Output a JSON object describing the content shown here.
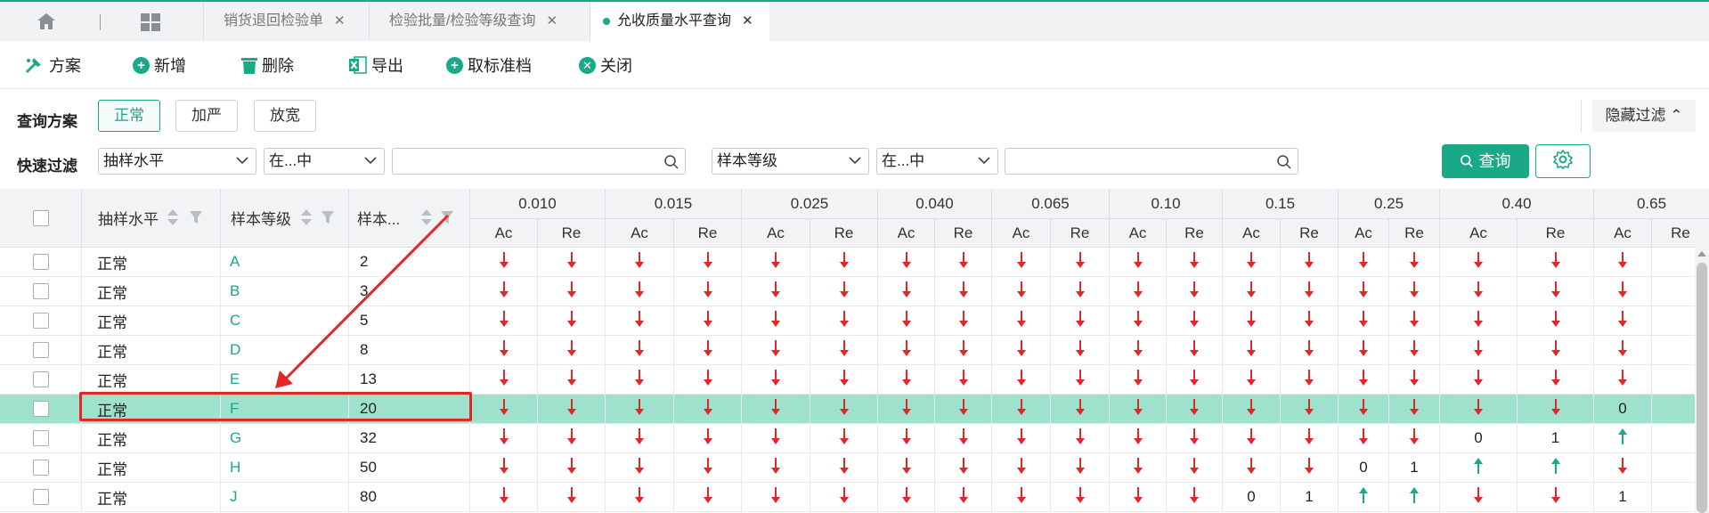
{
  "tabs": [
    {
      "label": "销货退回检验单",
      "active": false
    },
    {
      "label": "检验批量/检验等级查询",
      "active": false
    },
    {
      "label": "允收质量水平查询",
      "active": true
    }
  ],
  "toolbar": {
    "scheme": "方案",
    "add": "新增",
    "delete": "删除",
    "export": "导出",
    "cancel_std": "取标准档",
    "close": "关闭"
  },
  "filter": {
    "scheme_label": "查询方案",
    "schemes": [
      "正常",
      "加严",
      "放宽"
    ],
    "quick_label": "快速过滤",
    "hide_label": "隐藏过滤",
    "field1": "抽样水平",
    "op1": "在...中",
    "value1": "",
    "field2": "样本等级",
    "op2": "在...中",
    "value2": "",
    "query_label": "查询"
  },
  "table": {
    "col_headers": [
      "抽样水平",
      "样本等级",
      "样本..."
    ],
    "aql_levels": [
      "0.010",
      "0.015",
      "0.025",
      "0.040",
      "0.065",
      "0.10",
      "0.15",
      "0.25",
      "0.40",
      "0.65"
    ],
    "sub_ac": "Ac",
    "sub_re": "Re",
    "rows": [
      {
        "level": "正常",
        "grade": "A",
        "size": "2",
        "vals": [
          "d",
          "d",
          "d",
          "d",
          "d",
          "d",
          "d",
          "d",
          "d",
          "d",
          "d",
          "d",
          "d",
          "d",
          "d",
          "d",
          "d",
          "d",
          "d"
        ],
        "highlight": false
      },
      {
        "level": "正常",
        "grade": "B",
        "size": "3",
        "vals": [
          "d",
          "d",
          "d",
          "d",
          "d",
          "d",
          "d",
          "d",
          "d",
          "d",
          "d",
          "d",
          "d",
          "d",
          "d",
          "d",
          "d",
          "d",
          "d"
        ],
        "highlight": false
      },
      {
        "level": "正常",
        "grade": "C",
        "size": "5",
        "vals": [
          "d",
          "d",
          "d",
          "d",
          "d",
          "d",
          "d",
          "d",
          "d",
          "d",
          "d",
          "d",
          "d",
          "d",
          "d",
          "d",
          "d",
          "d",
          "d"
        ],
        "highlight": false
      },
      {
        "level": "正常",
        "grade": "D",
        "size": "8",
        "vals": [
          "d",
          "d",
          "d",
          "d",
          "d",
          "d",
          "d",
          "d",
          "d",
          "d",
          "d",
          "d",
          "d",
          "d",
          "d",
          "d",
          "d",
          "d",
          "d"
        ],
        "highlight": false
      },
      {
        "level": "正常",
        "grade": "E",
        "size": "13",
        "vals": [
          "d",
          "d",
          "d",
          "d",
          "d",
          "d",
          "d",
          "d",
          "d",
          "d",
          "d",
          "d",
          "d",
          "d",
          "d",
          "d",
          "d",
          "d",
          "d"
        ],
        "highlight": false
      },
      {
        "level": "正常",
        "grade": "F",
        "size": "20",
        "vals": [
          "d",
          "d",
          "d",
          "d",
          "d",
          "d",
          "d",
          "d",
          "d",
          "d",
          "d",
          "d",
          "d",
          "d",
          "d",
          "d",
          "d",
          "d",
          "0"
        ],
        "highlight": true
      },
      {
        "level": "正常",
        "grade": "G",
        "size": "32",
        "vals": [
          "d",
          "d",
          "d",
          "d",
          "d",
          "d",
          "d",
          "d",
          "d",
          "d",
          "d",
          "d",
          "d",
          "d",
          "d",
          "d",
          "0",
          "1",
          "u"
        ],
        "highlight": false
      },
      {
        "level": "正常",
        "grade": "H",
        "size": "50",
        "vals": [
          "d",
          "d",
          "d",
          "d",
          "d",
          "d",
          "d",
          "d",
          "d",
          "d",
          "d",
          "d",
          "d",
          "d",
          "0",
          "1",
          "u",
          "u",
          "d"
        ],
        "highlight": false
      },
      {
        "level": "正常",
        "grade": "J",
        "size": "80",
        "vals": [
          "d",
          "d",
          "d",
          "d",
          "d",
          "d",
          "d",
          "d",
          "d",
          "d",
          "d",
          "d",
          "0",
          "1",
          "u",
          "u",
          "d",
          "d",
          "1"
        ],
        "highlight": false
      }
    ]
  },
  "colors": {
    "accent": "#1aa987",
    "arrow_down": "#e32626",
    "arrow_up": "#1aa987",
    "highlight": "#9ee2cd"
  }
}
